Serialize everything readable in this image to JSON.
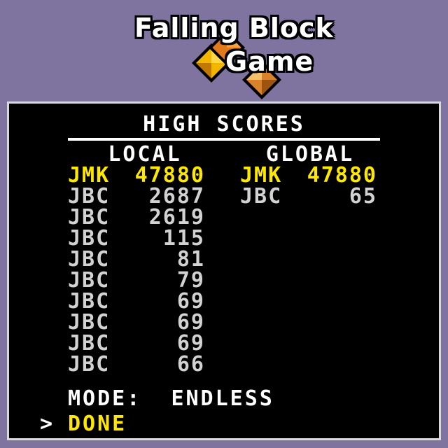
{
  "title": {
    "line1": "Falling Block",
    "line2": "Game"
  },
  "heading": "HIGH SCORES",
  "local": {
    "header": "LOCAL",
    "rows": [
      {
        "name": "JMK",
        "score": "47880",
        "highlight": true
      },
      {
        "name": "JBC",
        "score": "2687"
      },
      {
        "name": "JBC",
        "score": "2619"
      },
      {
        "name": "JBC",
        "score": "115"
      },
      {
        "name": "JBC",
        "score": "81"
      },
      {
        "name": "JBC",
        "score": "79"
      },
      {
        "name": "JBC",
        "score": "69"
      },
      {
        "name": "JBC",
        "score": "69"
      },
      {
        "name": "JBC",
        "score": "69"
      },
      {
        "name": "JBC",
        "score": "66"
      }
    ]
  },
  "global": {
    "header": "GLOBAL",
    "rows": [
      {
        "name": "JMK",
        "score": "47880",
        "highlight": true
      },
      {
        "name": "JBC",
        "score": "65"
      }
    ]
  },
  "mode": {
    "label": "MODE:",
    "value": "ENDLESS"
  },
  "menu": {
    "cursor": ">",
    "done": "DONE"
  },
  "colors": {
    "background": "#7f739f",
    "highlight": "#ffe800",
    "text": "#d2d2d2"
  }
}
